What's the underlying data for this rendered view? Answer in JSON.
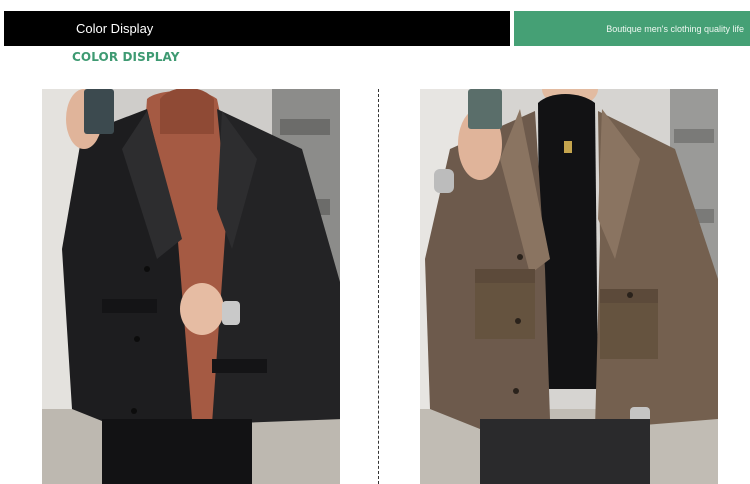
{
  "header": {
    "bar_label": "Color Display",
    "tagline": "Boutique men's clothing quality life",
    "accent_color": "#45a075"
  },
  "section": {
    "heading": "COLOR DISPLAY",
    "heading_color": "#3e9a72"
  },
  "products": [
    {
      "jacket_color": "black",
      "sweater": "rust turtleneck",
      "icon": "jacket-photo-black"
    },
    {
      "jacket_color": "brown",
      "sweater": "black turtleneck",
      "icon": "jacket-photo-brown"
    }
  ]
}
